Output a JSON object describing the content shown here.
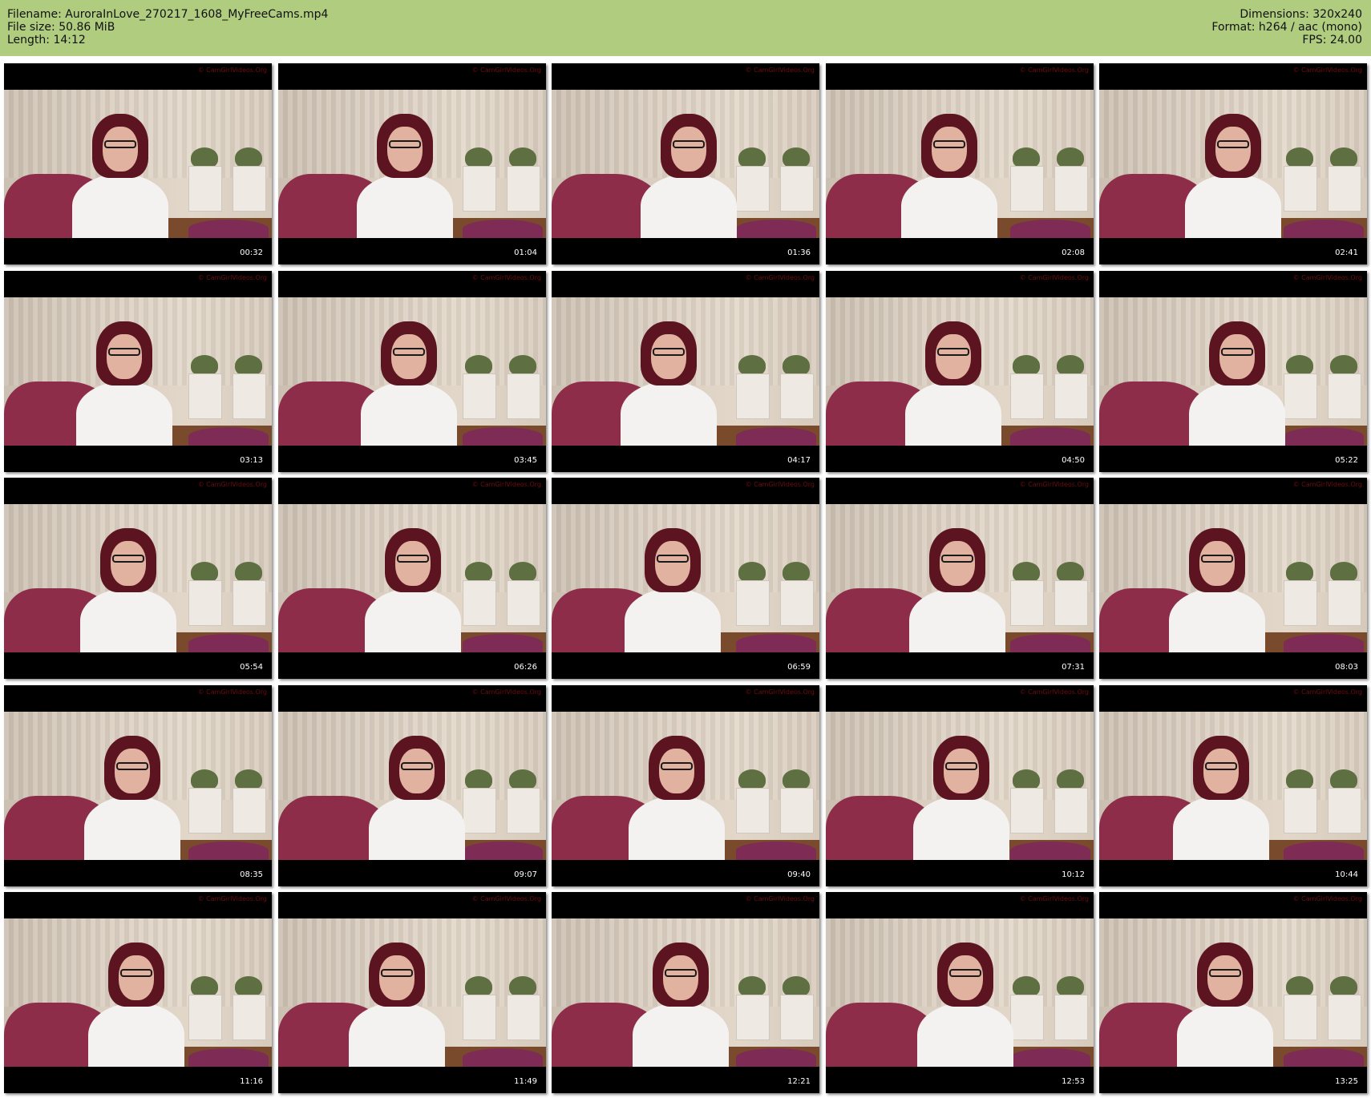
{
  "info": {
    "filename": "Filename: AuroraInLove_270217_1608_MyFreeCams.mp4",
    "file_size": "File size: 50.86 MiB",
    "length": "Length: 14:12",
    "dimensions": "Dimensions: 320x240",
    "format": "Format: h264 / aac (mono)",
    "fps": "FPS: 24.00"
  },
  "colors": {
    "header_bg": "#afcc7f",
    "tile_bg": "#000000",
    "timestamp_text": "#ffffff"
  },
  "watermark": "© CamGirlVideos.Org",
  "thumbnails": [
    {
      "timestamp": "00:32"
    },
    {
      "timestamp": "01:04"
    },
    {
      "timestamp": "01:36"
    },
    {
      "timestamp": "02:08"
    },
    {
      "timestamp": "02:41"
    },
    {
      "timestamp": "03:13"
    },
    {
      "timestamp": "03:45"
    },
    {
      "timestamp": "04:17"
    },
    {
      "timestamp": "04:50"
    },
    {
      "timestamp": "05:22"
    },
    {
      "timestamp": "05:54"
    },
    {
      "timestamp": "06:26"
    },
    {
      "timestamp": "06:59"
    },
    {
      "timestamp": "07:31"
    },
    {
      "timestamp": "08:03"
    },
    {
      "timestamp": "08:35"
    },
    {
      "timestamp": "09:07"
    },
    {
      "timestamp": "09:40"
    },
    {
      "timestamp": "10:12"
    },
    {
      "timestamp": "10:44"
    },
    {
      "timestamp": "11:16"
    },
    {
      "timestamp": "11:49"
    },
    {
      "timestamp": "12:21"
    },
    {
      "timestamp": "12:53"
    },
    {
      "timestamp": "13:25"
    }
  ]
}
